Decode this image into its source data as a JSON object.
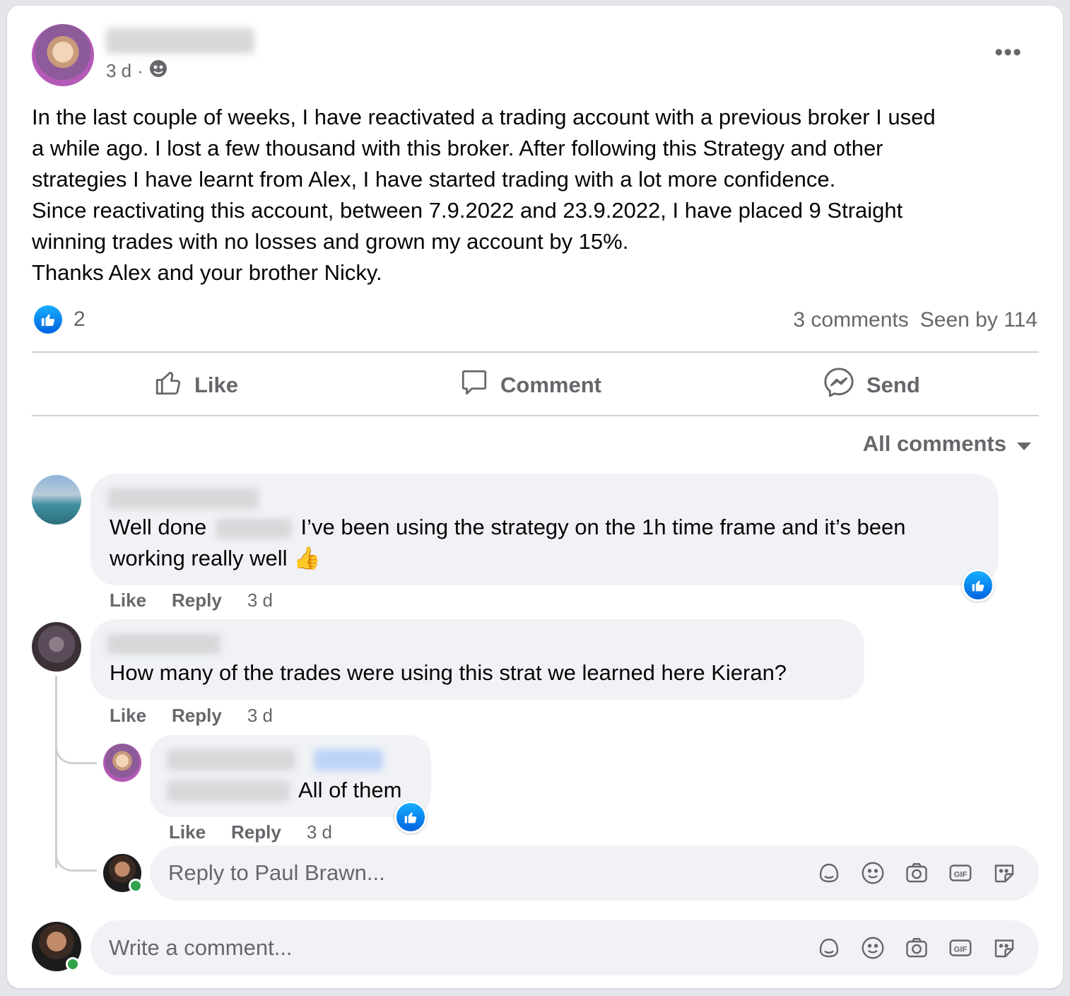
{
  "post": {
    "time": "3 d",
    "separator": "·",
    "more": "•••",
    "lines": [
      "In the last couple of weeks,  I have reactivated a trading account with a previous broker I used",
      "a while ago. I lost a few thousand with this broker. After following this Strategy and other",
      "strategies I have learnt from Alex, I have started trading with a lot more confidence.",
      "Since reactivating this account, between 7.9.2022 and 23.9.2022, I have placed 9 Straight",
      "winning trades with no losses and grown my account by 15%.",
      "Thanks Alex and your brother Nicky."
    ],
    "reaction_count": "2",
    "comments_count": "3 comments",
    "seen_by": "Seen by 114"
  },
  "actions": {
    "like": "Like",
    "comment": "Comment",
    "send": "Send"
  },
  "filter": {
    "label": "All comments"
  },
  "comments": [
    {
      "text_before": "Well done",
      "text_after": " I’ve been using the strategy on the 1h time frame and it’s been",
      "line2": "working really well",
      "emoji": "👍",
      "like": "Like",
      "reply": "Reply",
      "time": "3 d"
    },
    {
      "text": "How many of the trades were using this strat we learned here Kieran?",
      "like": "Like",
      "reply": "Reply",
      "time": "3 d"
    },
    {
      "text": "All of them",
      "like": "Like",
      "reply": "Reply",
      "time": "3 d"
    }
  ],
  "reply_input": {
    "placeholder": "Reply to Paul Brawn..."
  },
  "comment_input": {
    "placeholder": "Write a comment..."
  },
  "icons": {
    "like_badge": "thumbs-up-icon",
    "globe": "globe-icon",
    "avatar_sticker": "avatar-sticker-icon",
    "emoji": "smiley-icon",
    "camera": "camera-icon",
    "gif": "gif-icon",
    "sticker": "sticker-icon",
    "accent": "#0866ff",
    "online": "#31a24c"
  }
}
